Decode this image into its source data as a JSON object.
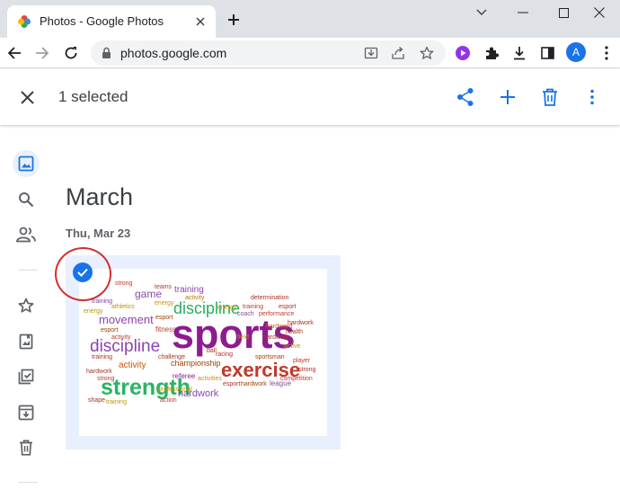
{
  "browser": {
    "tab_title": "Photos - Google Photos",
    "url": "photos.google.com",
    "profile_initial": "A"
  },
  "selection_bar": {
    "count_label": "1 selected"
  },
  "library": {
    "month": "March",
    "date": "Thu, Mar 23"
  },
  "wordcloud": {
    "words": [
      "sports",
      "strength",
      "discipline",
      "exercise",
      "movement",
      "fun",
      "game",
      "training",
      "activity",
      "hardwork",
      "championship",
      "referee",
      "coach",
      "fitness",
      "athletics",
      "energy",
      "esport",
      "strong",
      "sportsman",
      "health",
      "player",
      "performance",
      "determination",
      "competition",
      "league",
      "ball",
      "racing",
      "shape",
      "action",
      "activities",
      "gym",
      "jump",
      "professional",
      "sportsaholic",
      "teams",
      "field",
      "challenge",
      "hardword",
      "active"
    ]
  },
  "colors": {
    "accent": "#1a73e8",
    "annotation": "#d32f2f",
    "selected_bg": "#e8f0fe"
  }
}
